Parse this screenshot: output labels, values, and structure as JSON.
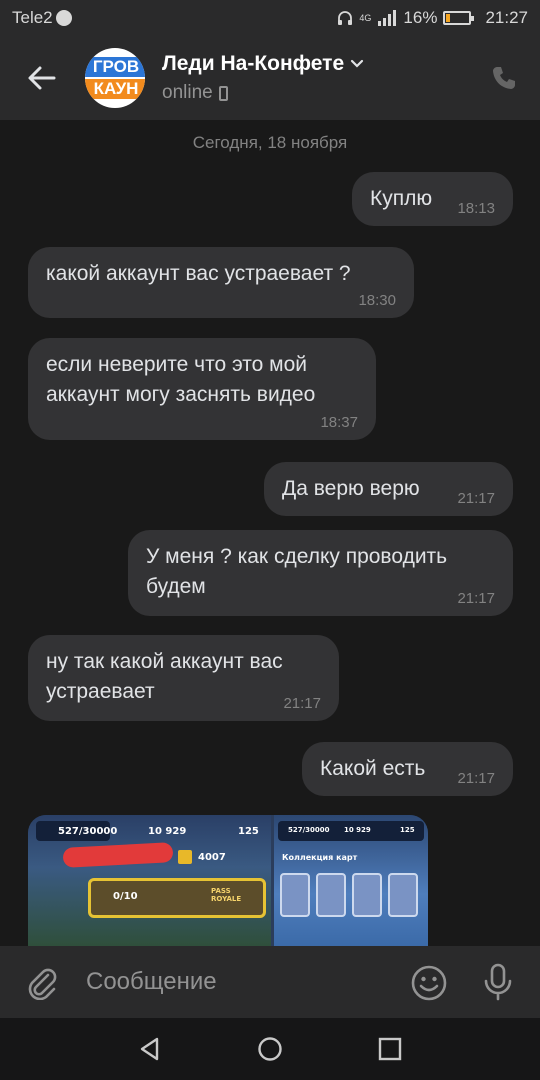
{
  "status_bar": {
    "carrier": "Tele2",
    "network_label": "4G",
    "battery_percent_text": "16%",
    "battery_level": 0.16,
    "time": "21:27"
  },
  "header": {
    "contact_name": "Леди На-Конфете",
    "avatar_line1": "ГРОВ",
    "avatar_line2": "КАУН",
    "status": "online"
  },
  "date_separator": "Сегодня, 18 ноября",
  "messages": [
    {
      "side": "out",
      "text": "Куплю",
      "time": "18:13"
    },
    {
      "side": "in",
      "text": "какой аккаунт вас устраевает ?",
      "time": "18:30"
    },
    {
      "side": "in",
      "text": "если неверите что это мой аккаунт могу заснять видео",
      "time": "18:37"
    },
    {
      "side": "out",
      "text": "Да верю верю",
      "time": "21:17"
    },
    {
      "side": "out",
      "text": "У меня ? как сделку проводить будем",
      "time": "21:17"
    },
    {
      "side": "in",
      "text": "ну так какой аккаунт вас устраевает",
      "time": "21:17"
    },
    {
      "side": "out",
      "text": "Какой есть",
      "time": "21:17"
    }
  ],
  "photo": {
    "left": {
      "xp": "527/30000",
      "gold": "10 929",
      "gems": "125",
      "trophies": "4007",
      "chest": "0/10",
      "pass": "PASS ROYALE"
    },
    "right": {
      "xp": "527/30000",
      "gold": "10 929",
      "gems": "125",
      "title": "Коллекция карт"
    }
  },
  "input": {
    "placeholder": "Сообщение"
  },
  "colors": {
    "background": "#191919",
    "bubble": "#333335",
    "bar": "#2a2a2b"
  }
}
